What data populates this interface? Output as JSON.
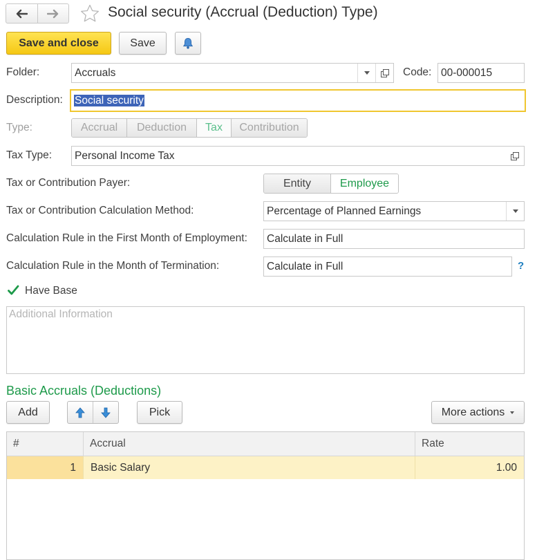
{
  "window": {
    "title": "Social security (Accrual (Deduction) Type)"
  },
  "toolbar": {
    "save_close_label": "Save and close",
    "save_label": "Save"
  },
  "form": {
    "folder": {
      "label": "Folder:",
      "value": "Accruals"
    },
    "code": {
      "label": "Code:",
      "value": "00-000015"
    },
    "description": {
      "label": "Description:",
      "value": "Social security"
    },
    "type": {
      "label": "Type:",
      "options": [
        "Accrual",
        "Deduction",
        "Tax",
        "Contribution"
      ],
      "selected": "Tax"
    },
    "tax_type": {
      "label": "Tax Type:",
      "value": "Personal Income Tax"
    },
    "payer": {
      "label": "Tax or Contribution Payer:",
      "options": [
        "Entity",
        "Employee"
      ],
      "selected": "Employee"
    },
    "calc_method": {
      "label": "Tax or Contribution Calculation Method:",
      "value": "Percentage of Planned Earnings"
    },
    "first_month_rule": {
      "label": "Calculation Rule in the First Month of Employment:",
      "value": "Calculate in Full"
    },
    "termination_rule": {
      "label": "Calculation Rule in the Month of Termination:",
      "value": "Calculate in Full",
      "help": "?"
    },
    "have_base": {
      "label": "Have Base",
      "checked": true
    },
    "additional_info": {
      "placeholder": "Additional Information",
      "value": ""
    }
  },
  "basic_accruals": {
    "title": "Basic Accruals (Deductions)",
    "add_label": "Add",
    "pick_label": "Pick",
    "more_actions_label": "More actions",
    "columns": [
      "#",
      "Accrual",
      "Rate"
    ],
    "rows": [
      {
        "num": "1",
        "accrual": "Basic Salary",
        "rate": "1.00"
      }
    ]
  },
  "colors": {
    "accent_green": "#1d9a4a",
    "primary_yellow": "#f5c814",
    "selection_blue": "#3d64b8",
    "row_highlight": "#fdf2c6"
  }
}
